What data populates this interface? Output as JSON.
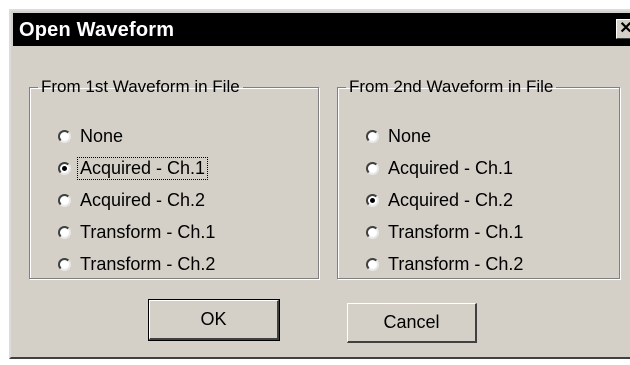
{
  "window": {
    "title": "Open Waveform",
    "close_glyph": "✕"
  },
  "group1": {
    "legend": "From 1st Waveform in File",
    "options": [
      {
        "label": "None",
        "checked": false
      },
      {
        "label": "Acquired - Ch.1",
        "checked": true
      },
      {
        "label": "Acquired - Ch.2",
        "checked": false
      },
      {
        "label": "Transform - Ch.1",
        "checked": false
      },
      {
        "label": "Transform - Ch.2",
        "checked": false
      }
    ]
  },
  "group2": {
    "legend": "From 2nd Waveform in File",
    "options": [
      {
        "label": "None",
        "checked": false
      },
      {
        "label": "Acquired - Ch.1",
        "checked": false
      },
      {
        "label": "Acquired - Ch.2",
        "checked": true
      },
      {
        "label": "Transform - Ch.1",
        "checked": false
      },
      {
        "label": "Transform - Ch.2",
        "checked": false
      }
    ]
  },
  "buttons": {
    "ok": "OK",
    "cancel": "Cancel"
  }
}
